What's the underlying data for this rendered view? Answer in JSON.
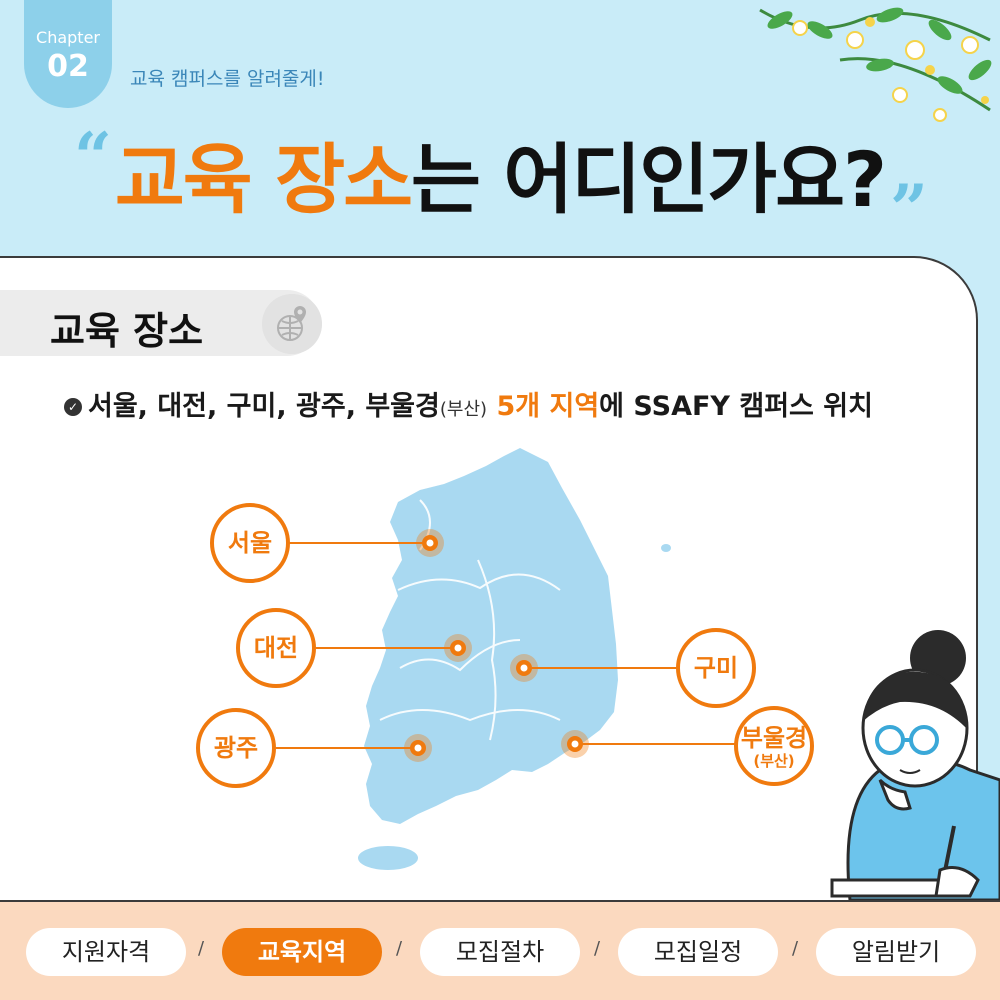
{
  "header": {
    "chapter_label": "Chapter",
    "chapter_number": "02",
    "chapter_subtitle": "교육 캠퍼스를 알려줄게!",
    "headline_accent": "교육 장소",
    "headline_rest": "는 어디인가요?",
    "quote_open": "“",
    "quote_close": "”"
  },
  "section": {
    "title": "교육 장소",
    "bullet_prefix": "서울, 대전, 구미, 광주, 부울경",
    "bullet_paren": "(부산)",
    "bullet_highlight": "5개 지역",
    "bullet_suffix": "에 SSAFY 캠퍼스 위치"
  },
  "cities": {
    "seoul": "서울",
    "daejeon": "대전",
    "gumi": "구미",
    "gwangju": "광주",
    "bug_main": "부울경",
    "bug_sub": "(부산)"
  },
  "nav": {
    "items": [
      "지원자격",
      "교육지역",
      "모집절차",
      "모집일정",
      "알림받기"
    ],
    "separator": "/"
  },
  "colors": {
    "accent": "#f07a0e",
    "map": "#a9d9f1",
    "background": "#c9ecf8"
  }
}
